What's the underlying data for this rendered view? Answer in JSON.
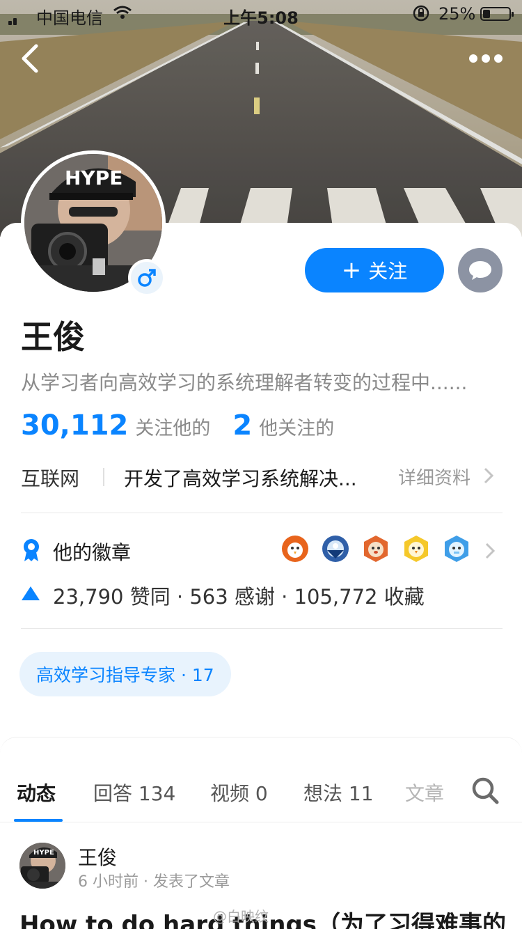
{
  "status_bar": {
    "carrier": "中国电信",
    "time": "上午5:08",
    "battery": "25%"
  },
  "profile": {
    "name": "王俊",
    "bio": "从学习者向高效学习的系统理解者转变的过程中......",
    "follow_label": "关注",
    "followers_count": "30,112",
    "followers_label": "关注他的",
    "following_count": "2",
    "following_label": "他关注的",
    "industry": "互联网",
    "intro": "开发了高效学习系统解决...",
    "detail_link": "详细资料",
    "badges_label": "他的徽章",
    "badge_icons": [
      "bird-badge-icon",
      "globe-badge-icon",
      "fox-badge-icon",
      "chick-badge-icon",
      "ice-badge-icon"
    ],
    "stats_line": "23,790 赞同 · 563 感谢 · 105,772 收藏",
    "expert_tag": "高效学习指导专家 · 17"
  },
  "tabs": {
    "dynamics": "动态",
    "answers": "回答 134",
    "videos": "视频 0",
    "ideas": "想法 11",
    "articles": "文章"
  },
  "feed": {
    "author": "王俊",
    "meta": "6 小时前 · 发表了文章",
    "title": "How to do hard things（为了习得难事的",
    "watermark": "@白映纹"
  },
  "colors": {
    "accent": "#0a84ff",
    "tag_bg": "#e8f3fd",
    "muted": "#8a8a8a"
  }
}
